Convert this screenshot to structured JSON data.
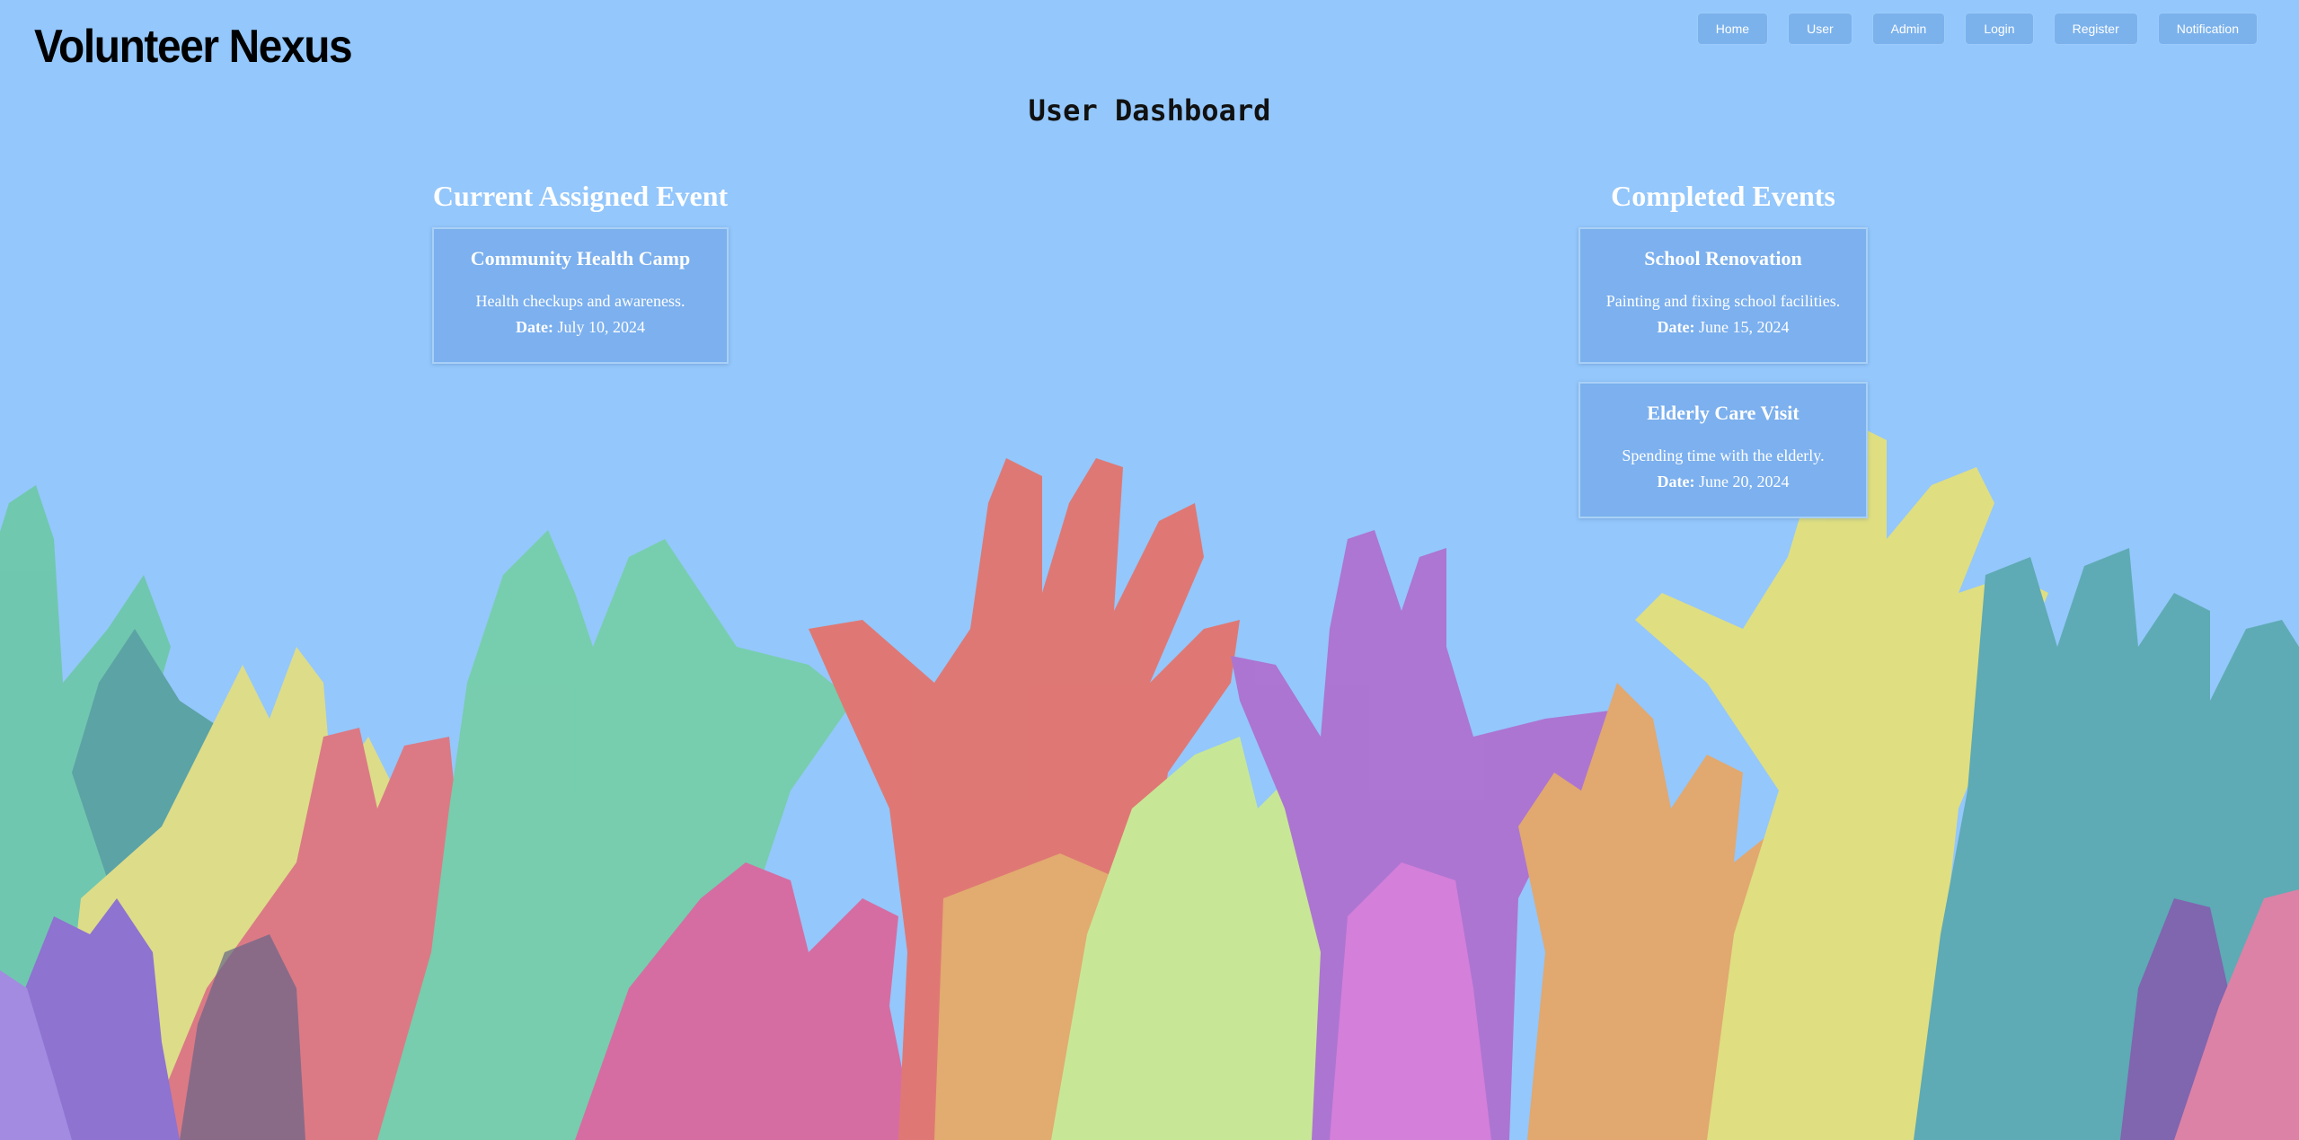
{
  "header": {
    "brand": "Volunteer Nexus",
    "nav": [
      {
        "label": "Home"
      },
      {
        "label": "User"
      },
      {
        "label": "Admin"
      },
      {
        "label": "Login"
      },
      {
        "label": "Register"
      },
      {
        "label": "Notification"
      }
    ]
  },
  "page": {
    "title": "User Dashboard"
  },
  "current": {
    "heading": "Current Assigned Event",
    "events": [
      {
        "title": "Community Health Camp",
        "description": "Health checkups and awareness.",
        "date_label": "Date:",
        "date": "July 10, 2024"
      }
    ]
  },
  "completed": {
    "heading": "Completed Events",
    "events": [
      {
        "title": "School Renovation",
        "description": "Painting and fixing school facilities.",
        "date_label": "Date:",
        "date": "June 15, 2024"
      },
      {
        "title": "Elderly Care Visit",
        "description": "Spending time with the elderly.",
        "date_label": "Date:",
        "date": "June 20, 2024"
      }
    ]
  },
  "colors": {
    "background": "#94c7fb",
    "nav_button": "#7bb2ec",
    "card": "#7cb0ee"
  }
}
